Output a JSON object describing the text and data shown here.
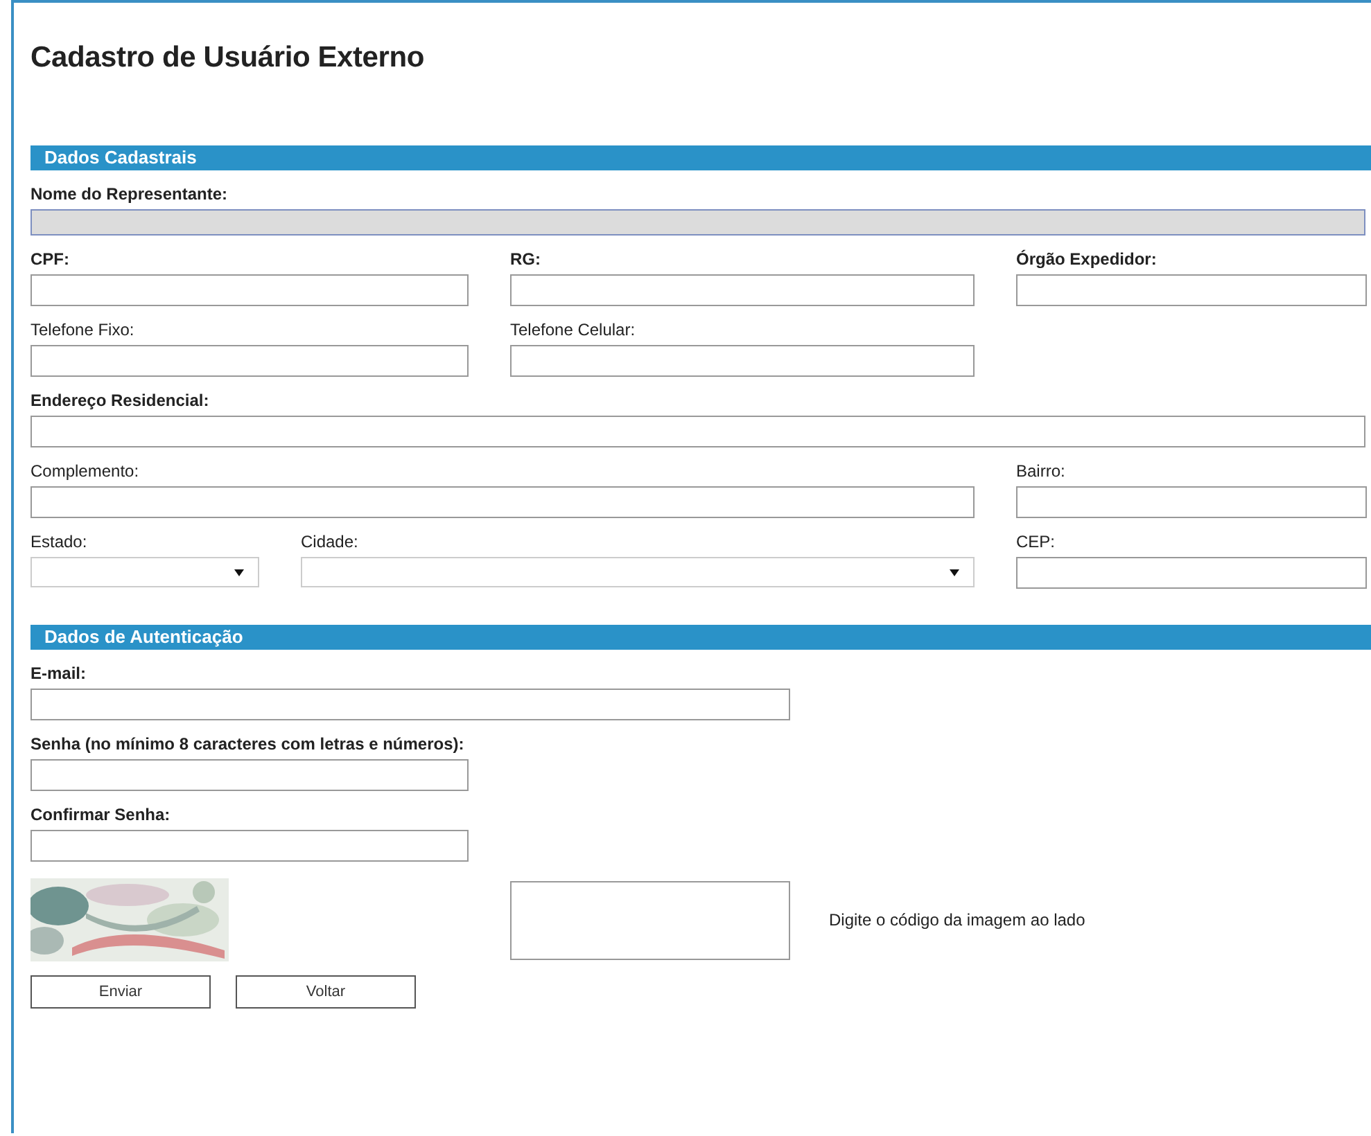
{
  "title": "Cadastro de Usuário Externo",
  "sections": [
    {
      "heading": "Dados Cadastrais",
      "fields": [
        {
          "label": "Nome do Representante:",
          "bold": true,
          "kind": "text",
          "disabled": true
        },
        {
          "label": "CPF:",
          "bold": true,
          "kind": "text",
          "disabled": false
        },
        {
          "label": "RG:",
          "bold": true,
          "kind": "text",
          "disabled": false
        },
        {
          "label": "Órgão Expedidor:",
          "bold": true,
          "kind": "text",
          "disabled": false
        },
        {
          "label": "Telefone Fixo:",
          "bold": false,
          "kind": "text",
          "disabled": false
        },
        {
          "label": "Telefone Celular:",
          "bold": false,
          "kind": "text",
          "disabled": false
        },
        {
          "label": "Endereço Residencial:",
          "bold": true,
          "kind": "text",
          "disabled": false
        },
        {
          "label": "Complemento:",
          "bold": false,
          "kind": "text",
          "disabled": false
        },
        {
          "label": "Bairro:",
          "bold": false,
          "kind": "text",
          "disabled": false
        },
        {
          "label": "Estado:",
          "bold": false,
          "kind": "select",
          "disabled": false
        },
        {
          "label": "Cidade:",
          "bold": false,
          "kind": "select",
          "disabled": false
        },
        {
          "label": "CEP:",
          "bold": false,
          "kind": "text",
          "disabled": false
        }
      ]
    },
    {
      "heading": "Dados de Autenticação",
      "fields": [
        {
          "label": "E-mail:",
          "bold": true,
          "kind": "text",
          "disabled": false
        },
        {
          "label": "Senha (no mínimo 8 caracteres com letras e números):",
          "bold": true,
          "kind": "text",
          "disabled": false
        },
        {
          "label": "Confirmar Senha:",
          "bold": true,
          "kind": "text",
          "disabled": false
        }
      ]
    }
  ],
  "captcha": {
    "hint": "Digite o código da imagem ao lado"
  },
  "buttons": [
    "Enviar",
    "Voltar"
  ]
}
